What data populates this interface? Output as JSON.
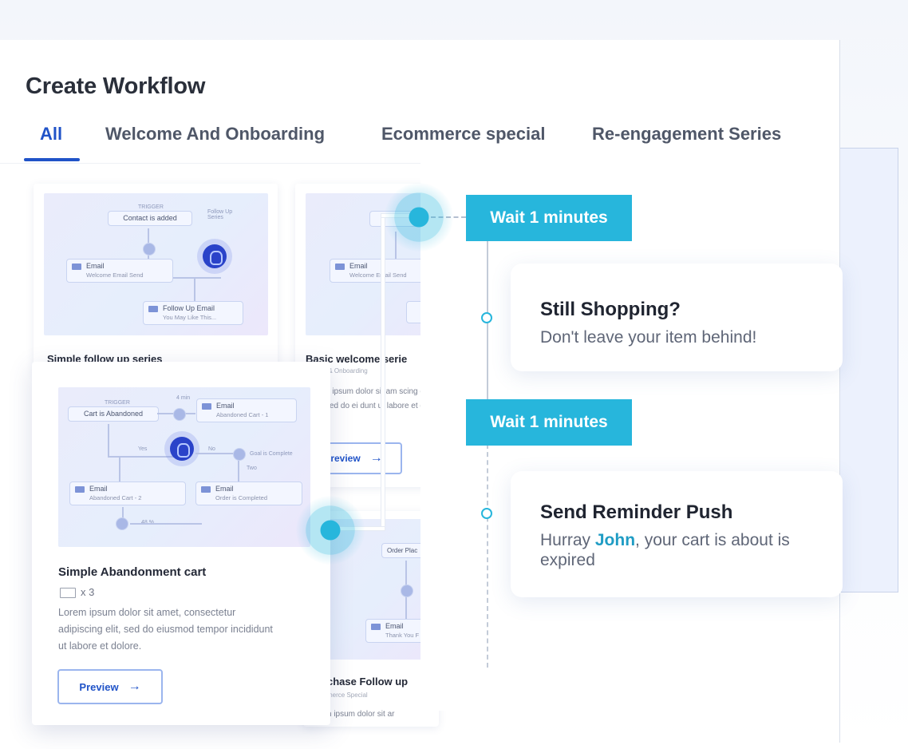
{
  "header": {
    "title": "Create Workflow"
  },
  "tabs": [
    {
      "label": "All",
      "active": true
    },
    {
      "label": "Welcome And Onboarding",
      "active": false
    },
    {
      "label": "Ecommerce special",
      "active": false
    },
    {
      "label": "Re-engagement Series",
      "active": false
    }
  ],
  "cards": {
    "simple_follow_up": {
      "title": "Simple follow up series",
      "nodes": {
        "trigger": "Contact is added",
        "trigger_label": "TRIGGER",
        "side_label": "Follow Up Series",
        "email_title": "Email",
        "email_sub": "Welcome Email Send",
        "followup_title": "Follow Up Email",
        "followup_sub": "You May Like This..."
      }
    },
    "basic_welcome": {
      "title": "Basic welcome serie",
      "category": "me & Onboarding",
      "description": "n ipsum dolor sit am scing elit, sed do ei dunt ut labore et do",
      "preview_label": "review",
      "nodes": {
        "email_title": "Email",
        "email_sub": "Welcome Email Send"
      }
    },
    "abandonment": {
      "title": "Simple Abandonment cart",
      "count": "x 3",
      "description": "Lorem ipsum dolor sit amet, consectetur adipiscing elit, sed do eiusmod tempor incididunt ut labore et dolore.",
      "preview_label": "Preview",
      "nodes": {
        "trigger": "Cart is Abandoned",
        "trigger_label": "TRIGGER",
        "email1_title": "Email",
        "email1_sub": "Abandoned Cart - 1",
        "email2_title": "Email",
        "email2_sub": "Abandoned Cart - 2",
        "email3_title": "Email",
        "email3_sub": "Order is Completed",
        "label_wait": "4 min",
        "label_yes": "Yes",
        "label_no": "No",
        "label_goal": "Goal is Complete",
        "label_two": "Two",
        "label_pct": "48 %"
      }
    },
    "purchase_follow_up": {
      "title": "chase Follow up",
      "category": "merce Special",
      "description": "n ipsum dolor sit ar",
      "nodes": {
        "trigger": "Order Plac",
        "email_title": "Email",
        "email_sub": "Thank You F"
      }
    }
  },
  "timeline": {
    "steps": [
      {
        "type": "wait",
        "label": "Wait 1 minutes"
      },
      {
        "type": "message",
        "title": "Still Shopping?",
        "body": "Don't leave your item behind!"
      },
      {
        "type": "wait",
        "label": "Wait 1 minutes"
      },
      {
        "type": "message",
        "title": "Send Reminder Push",
        "body_prefix": "Hurray ",
        "body_name": "John",
        "body_suffix": ", your cart is about is expired"
      }
    ]
  },
  "colors": {
    "accent_blue": "#2053c8",
    "teal": "#27b6dc",
    "highlight_name": "#1f9cc4"
  },
  "icons": [
    "mail-icon",
    "envelope-icon",
    "arrow-right-icon",
    "avatar-icon"
  ]
}
